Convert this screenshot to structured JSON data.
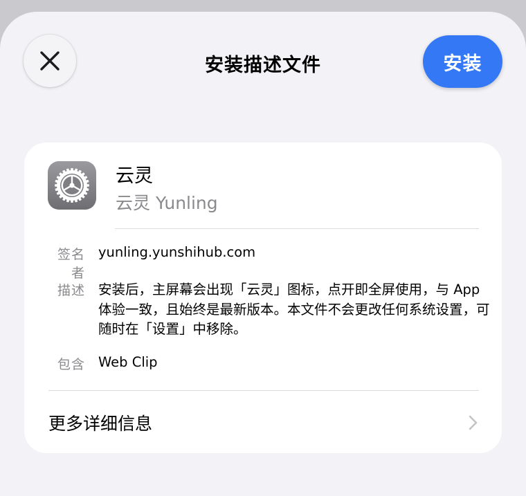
{
  "header": {
    "title": "安装描述文件",
    "close_icon": "close-icon",
    "install_label": "安装",
    "accent_color": "#3478f6"
  },
  "profile": {
    "icon": "settings-gear-icon",
    "name": "云灵",
    "subtitle": "云灵 Yunling",
    "signer_label": "签名者",
    "signer_value": "yunling.yunshihub.com",
    "description_label": "描述",
    "description_value": "安装后，主屏幕会出现「云灵」图标，点开即全屏使用，与 App 体验一致，且始终是最新版本。本文件不会更改任何系统设置，可随时在「设置」中移除。",
    "contains_label": "包含",
    "contains_value": "Web Clip"
  },
  "more_info": {
    "label": "更多详细信息",
    "icon": "chevron-right-icon"
  }
}
